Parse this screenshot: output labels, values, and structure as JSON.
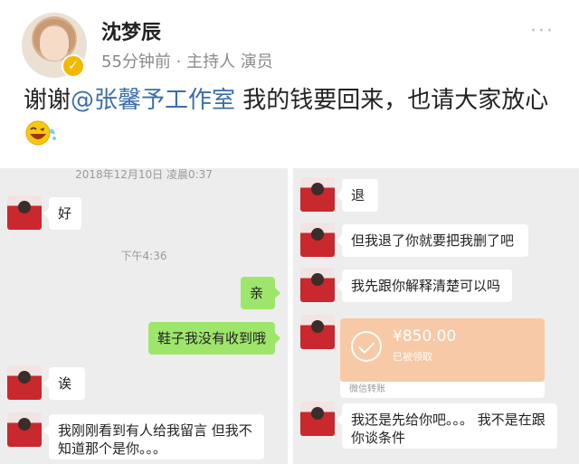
{
  "post": {
    "username": "沈梦辰",
    "meta": "55分钟前 · 主持人 演员",
    "more_icon": "more-dots-icon",
    "text_before": "谢谢",
    "mention": "@张馨予工作室",
    "text_after": " 我的钱要回来，也请大家放心",
    "emoji": "laughing-wink-emoji"
  },
  "chat_left": {
    "timestamp_top": "2018年12月10日 凌晨0:37",
    "timestamp_mid": "下午4:36",
    "messages": [
      {
        "side": "in",
        "text": "好"
      },
      {
        "side": "out",
        "text": "亲"
      },
      {
        "side": "out",
        "text": "鞋子我没有收到哦"
      },
      {
        "side": "in",
        "text": "诶"
      },
      {
        "side": "in",
        "text": "我刚刚看到有人给我留言 但我不知道那个是你。。。"
      }
    ]
  },
  "chat_right": {
    "messages": [
      {
        "side": "in",
        "text": "退"
      },
      {
        "side": "in",
        "text": "但我退了你就要把我删了吧"
      },
      {
        "side": "in",
        "text": "我先跟你解释清楚可以吗"
      },
      {
        "side": "in",
        "text": "我还是先给你吧。。。 我不是在跟你谈条件"
      }
    ],
    "transfer": {
      "amount": "¥850.00",
      "status": "已被领取",
      "footer": "微信转账",
      "icon": "check-circle-icon"
    }
  },
  "colors": {
    "mention": "#3b6ea8",
    "outgoing_bubble": "#9ee66b",
    "transfer_card": "#f8c9a6",
    "verified": "#f5b800"
  }
}
